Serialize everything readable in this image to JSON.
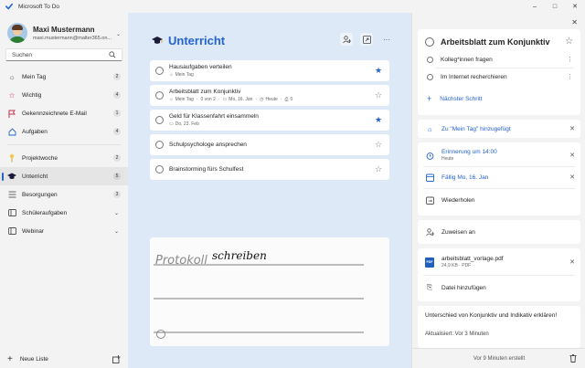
{
  "window": {
    "title": "Microsoft To Do",
    "controls": [
      "–",
      "□",
      "✕"
    ]
  },
  "profile": {
    "name": "Maxi Mustermann",
    "email": "maxi.mustermann@malter365.on..."
  },
  "search": {
    "placeholder": "Suchen"
  },
  "sidebar": {
    "items": [
      {
        "label": "Mein Tag",
        "icon": "sun-icon",
        "count": "2"
      },
      {
        "label": "Wichtig",
        "icon": "star-icon",
        "count": "4"
      },
      {
        "label": "Gekennzeichnete E-Mail",
        "icon": "flag-icon",
        "count": "1"
      },
      {
        "label": "Aufgaben",
        "icon": "home-icon",
        "count": "4"
      },
      {
        "label": "Projektwoche",
        "icon": "pin-icon",
        "count": "2"
      },
      {
        "label": "Unterricht",
        "icon": "graduation-cap-icon",
        "count": "5",
        "active": true
      },
      {
        "label": "Besorgungen",
        "icon": "list-icon",
        "count": "3"
      },
      {
        "label": "Schüleraufgaben",
        "icon": "group-icon",
        "chevron": true
      },
      {
        "label": "Webinar",
        "icon": "group-icon",
        "chevron": true
      }
    ],
    "new_list": "Neue Liste"
  },
  "main": {
    "title": "Unterricht",
    "tasks": [
      {
        "title": "Hausaufgaben verteilen",
        "meta": [
          "Mein Tag"
        ],
        "starred": true
      },
      {
        "title": "Arbeitsblatt zum Konjunktiv",
        "meta": [
          "Mein Tag",
          "0 von 2",
          "Mo, 16. Jan",
          "Heute",
          "0"
        ],
        "starred": false
      },
      {
        "title": "Geld für Klassenfahrt einsammeln",
        "meta": [
          "Do, 23. Feb"
        ],
        "starred": true
      },
      {
        "title": "Schulpsychologe ansprechen",
        "meta": [],
        "starred": false
      },
      {
        "title": "Brainstorming fürs Schulfest",
        "meta": [],
        "starred": false
      }
    ],
    "notes": {
      "handwriting_1": "Protokoll",
      "handwriting_2": "schreiben"
    }
  },
  "detail": {
    "title": "Arbeitsblatt zum Konjunktiv",
    "steps": [
      "Kolleg*innen fragen",
      "Im Internet recherchieren"
    ],
    "next_step": "Nächster Schritt",
    "my_day": "Zu \"Mein Tag\" hinzugefügt",
    "reminder": {
      "label": "Erinnerung um 14:00",
      "sub": "Heute"
    },
    "due": "Fällig Mo, 16. Jan",
    "repeat": "Wiederholen",
    "assign": "Zuweisen an",
    "file": {
      "name": "arbeitsblatt_vorlage.pdf",
      "meta": "24,9 KB · PDF",
      "badge": "PDF"
    },
    "add_file": "Datei hinzufügen",
    "note": "Unterschied von Konjunktiv und Indikativ erklären!",
    "updated": "Aktualisiert: Vor 3 Minuten",
    "created": "Vor 9 Minuten erstellt"
  },
  "colors": {
    "accent": "#2564cf",
    "main_bg": "#dde9f6"
  }
}
